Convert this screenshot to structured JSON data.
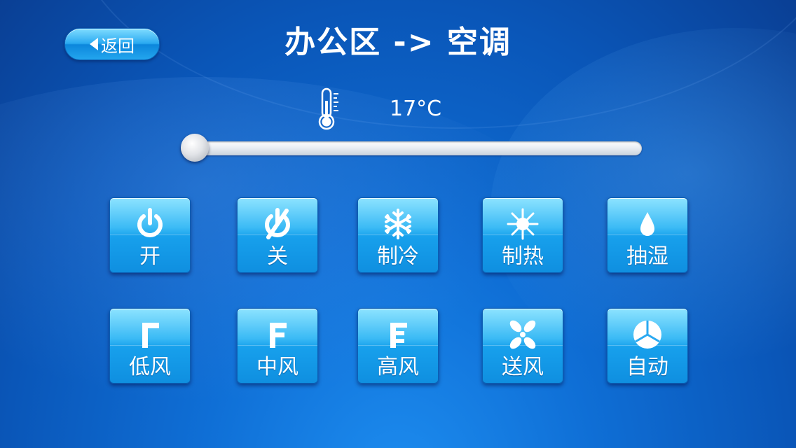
{
  "header": {
    "back_label": "返回",
    "title": "办公区 -> 空调"
  },
  "temperature": {
    "value_text": "17°C",
    "slider_level": 0.0
  },
  "modes": [
    {
      "label": "开",
      "icon": "power-icon"
    },
    {
      "label": "关",
      "icon": "power-off-icon"
    },
    {
      "label": "制冷",
      "icon": "snowflake-icon"
    },
    {
      "label": "制热",
      "icon": "sun-icon"
    },
    {
      "label": "抽湿",
      "icon": "water-drop-icon"
    }
  ],
  "fan_speeds": [
    {
      "label": "低风",
      "icon": "fan-low-icon"
    },
    {
      "label": "中风",
      "icon": "fan-medium-icon"
    },
    {
      "label": "高风",
      "icon": "fan-high-icon"
    },
    {
      "label": "送风",
      "icon": "fan-icon"
    },
    {
      "label": "自动",
      "icon": "auto-icon"
    }
  ],
  "colors": {
    "background": "#0a56b8",
    "tile_accent": "#17a0ec",
    "text": "#ffffff"
  }
}
